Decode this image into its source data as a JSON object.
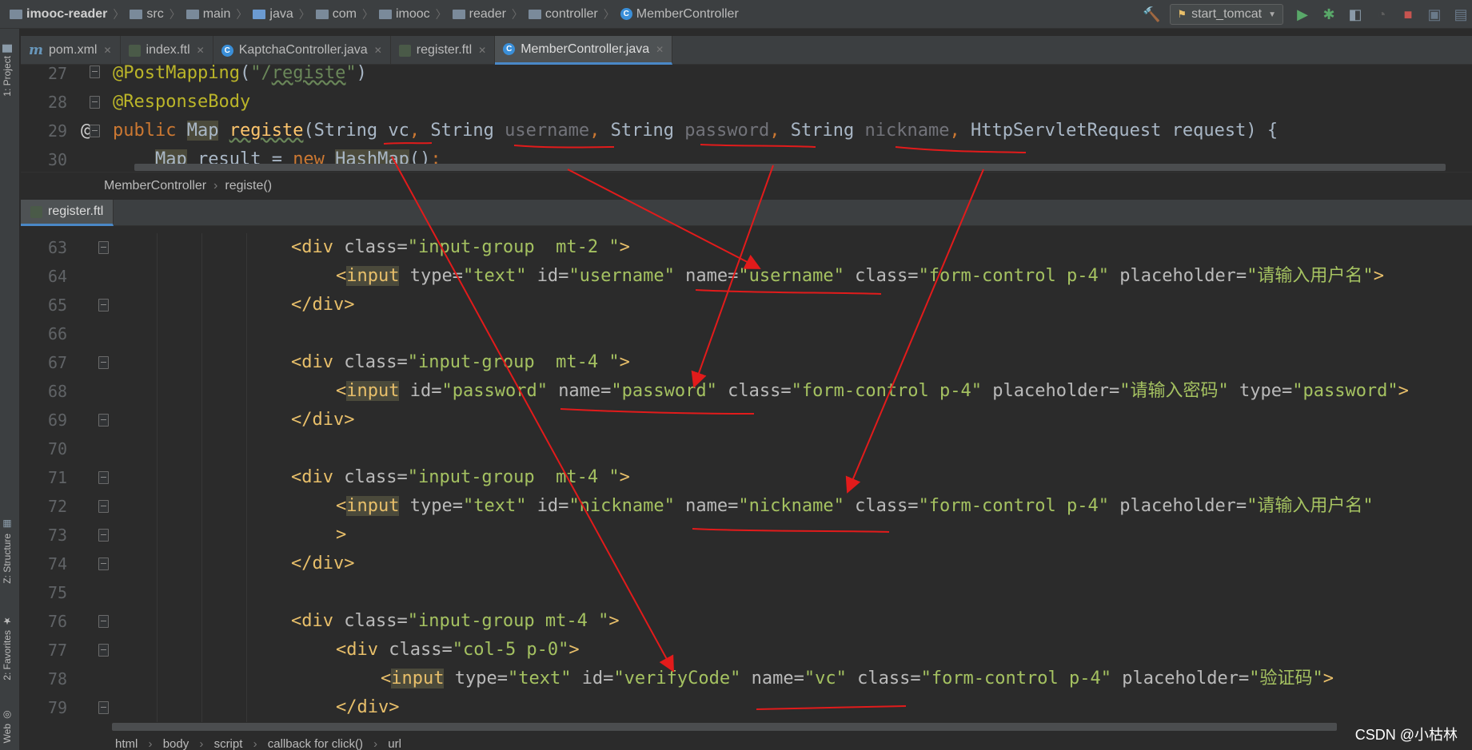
{
  "nav": {
    "project": "imooc-reader",
    "crumbs": [
      "src",
      "main",
      "java",
      "com",
      "imooc",
      "reader",
      "controller"
    ],
    "current": "MemberController",
    "run_config": "start_tomcat"
  },
  "side_tabs": {
    "project": "1: Project",
    "structure": "Z: Structure",
    "favorites": "2: Favorites",
    "web": "Web"
  },
  "tabs": [
    "pom.xml",
    "index.ftl",
    "KaptchaController.java",
    "register.ftl",
    "MemberController.java"
  ],
  "java": {
    "lines": [
      {
        "n": "27",
        "text": "@PostMapping(\"/registe\")"
      },
      {
        "n": "28",
        "text": "@ResponseBody"
      },
      {
        "n": "29",
        "text": "public Map registe(String vc, String username, String password, String nickname, HttpServletRequest request) {"
      },
      {
        "n": "30",
        "text": "    Map result = new HashMap();"
      }
    ],
    "gutter_mark": "@",
    "breadcrumb": [
      "MemberController",
      "registe()"
    ]
  },
  "ftl": {
    "tab": "register.ftl",
    "lines": [
      {
        "n": "63",
        "text": "<div class=\"input-group  mt-2 \">"
      },
      {
        "n": "64",
        "text": "<input type=\"text\" id=\"username\" name=\"username\" class=\"form-control p-4\" placeholder=\"请输入用户名\">"
      },
      {
        "n": "65",
        "text": "</div>"
      },
      {
        "n": "66",
        "text": ""
      },
      {
        "n": "67",
        "text": "<div class=\"input-group  mt-4 \">"
      },
      {
        "n": "68",
        "text": "<input id=\"password\" name=\"password\" class=\"form-control p-4\" placeholder=\"请输入密码\" type=\"password\">"
      },
      {
        "n": "69",
        "text": "</div>"
      },
      {
        "n": "70",
        "text": ""
      },
      {
        "n": "71",
        "text": "<div class=\"input-group  mt-4 \">"
      },
      {
        "n": "72",
        "text": "<input type=\"text\" id=\"nickname\" name=\"nickname\" class=\"form-control p-4\" placeholder=\"请输入用户名\""
      },
      {
        "n": "73",
        "text": ">"
      },
      {
        "n": "74",
        "text": "</div>"
      },
      {
        "n": "75",
        "text": ""
      },
      {
        "n": "76",
        "text": "<div class=\"input-group mt-4 \">"
      },
      {
        "n": "77",
        "text": "<div class=\"col-5 p-0\">"
      },
      {
        "n": "78",
        "text": "<input type=\"text\" id=\"verifyCode\" name=\"vc\" class=\"form-control p-4\" placeholder=\"验证码\">"
      },
      {
        "n": "79",
        "text": "</div>"
      }
    ],
    "breadcrumb": [
      "html",
      "body",
      "script",
      "callback for click()",
      "url"
    ]
  },
  "watermark": "CSDN @小枯林",
  "colors": {
    "annotation_red": "#e21b1b",
    "keyword": "#cc7832",
    "string": "#6a8759",
    "tag": "#e8bf6a",
    "attr_value": "#a5c261"
  }
}
